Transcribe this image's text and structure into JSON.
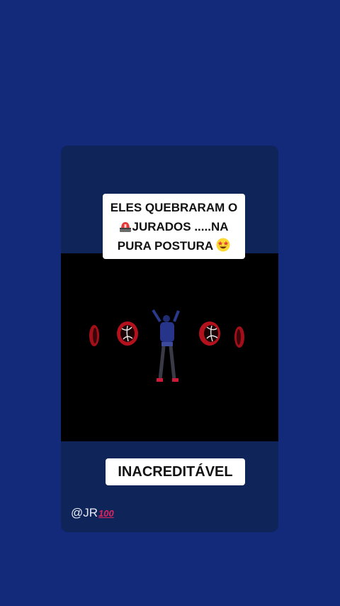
{
  "story": {
    "caption_top_lines": [
      "ELES QUEBRARAM O",
      "JURADOS .....NA",
      "PURA POSTURA"
    ],
    "caption_bottom": "INACREDITÁVEL",
    "handle": "@JR",
    "handle_badge": "100",
    "icons": [
      "police-siren-emoji-icon",
      "star-struck-emoji-icon"
    ]
  },
  "video": {
    "description_icons": [
      "dancer-figure",
      "red-hoop-prop",
      "red-fan-prop"
    ]
  },
  "colors": {
    "background": "#13297a",
    "card": "#0f2459",
    "video": "#000000",
    "caption_bg": "#ffffff",
    "accent_red": "#c0121e"
  }
}
